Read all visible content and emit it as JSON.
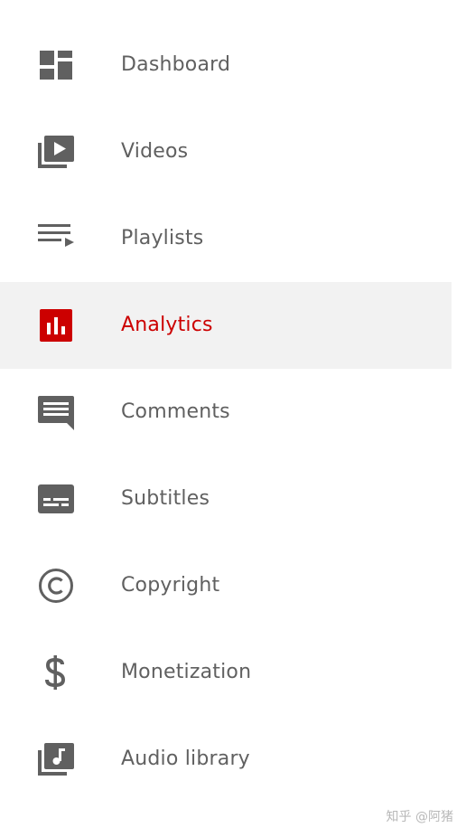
{
  "nav": {
    "items": [
      {
        "label": "Dashboard",
        "icon": "dashboard-icon",
        "active": false
      },
      {
        "label": "Videos",
        "icon": "videos-icon",
        "active": false
      },
      {
        "label": "Playlists",
        "icon": "playlist-icon",
        "active": false
      },
      {
        "label": "Analytics",
        "icon": "analytics-icon",
        "active": true
      },
      {
        "label": "Comments",
        "icon": "comments-icon",
        "active": false
      },
      {
        "label": "Subtitles",
        "icon": "subtitles-icon",
        "active": false
      },
      {
        "label": "Copyright",
        "icon": "copyright-icon",
        "active": false
      },
      {
        "label": "Monetization",
        "icon": "dollar-icon",
        "active": false
      },
      {
        "label": "Audio library",
        "icon": "audio-library-icon",
        "active": false
      }
    ]
  },
  "colors": {
    "text": "#606060",
    "icon": "#606060",
    "active": "#cc0000",
    "active_bg": "#f2f2f2"
  },
  "watermark": "知乎 @阿猪"
}
